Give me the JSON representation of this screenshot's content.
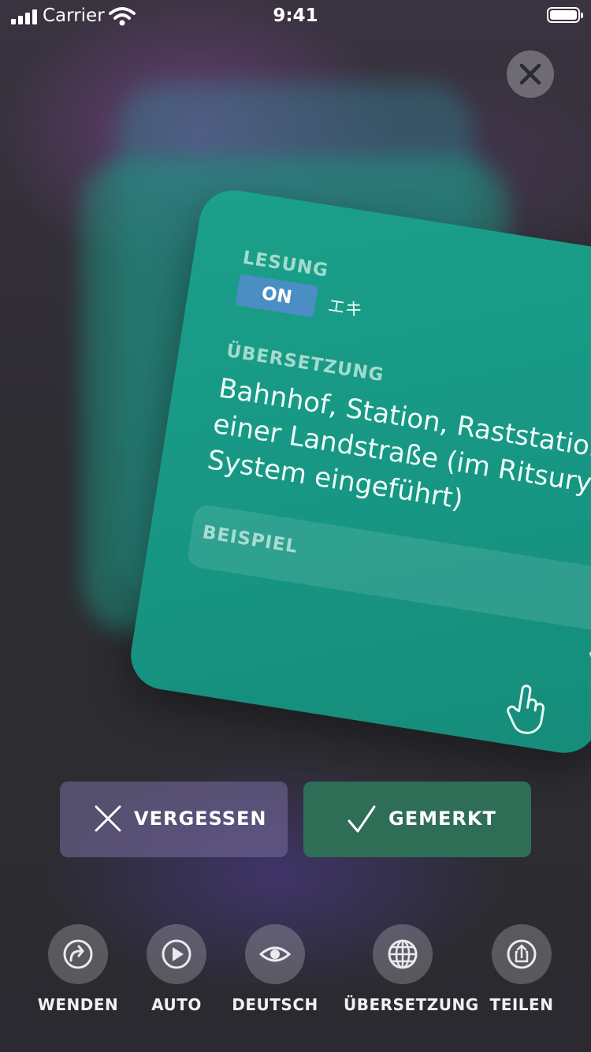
{
  "status_bar": {
    "carrier": "Carrier",
    "time": "9:41"
  },
  "card": {
    "reading_label": "LESUNG",
    "reading_toggle": "ON",
    "reading_value": "エキ",
    "translation_label": "ÜBERSETZUNG",
    "translation_text": "Bahnhof, Station, Raststation einer Landstraße (im Ritsuryō-System eingeführt)",
    "example_label": "BEISPIEL"
  },
  "actions": {
    "forget_label": "VERGESSEN",
    "remembered_label": "GEMERKT"
  },
  "toolbar": [
    {
      "label": "WENDEN",
      "icon": "turn-arrow-icon"
    },
    {
      "label": "AUTO",
      "icon": "play-icon"
    },
    {
      "label": "DEUTSCH",
      "icon": "eye-icon"
    },
    {
      "label": "ÜBERSETZUNG",
      "icon": "globe-icon"
    },
    {
      "label": "TEILEN",
      "icon": "share-icon"
    }
  ],
  "colors": {
    "card": "#1ba08a",
    "toggle_on": "#4a8ec4",
    "remembered_button": "#2f6e56",
    "forget_button": "#6d6690"
  }
}
